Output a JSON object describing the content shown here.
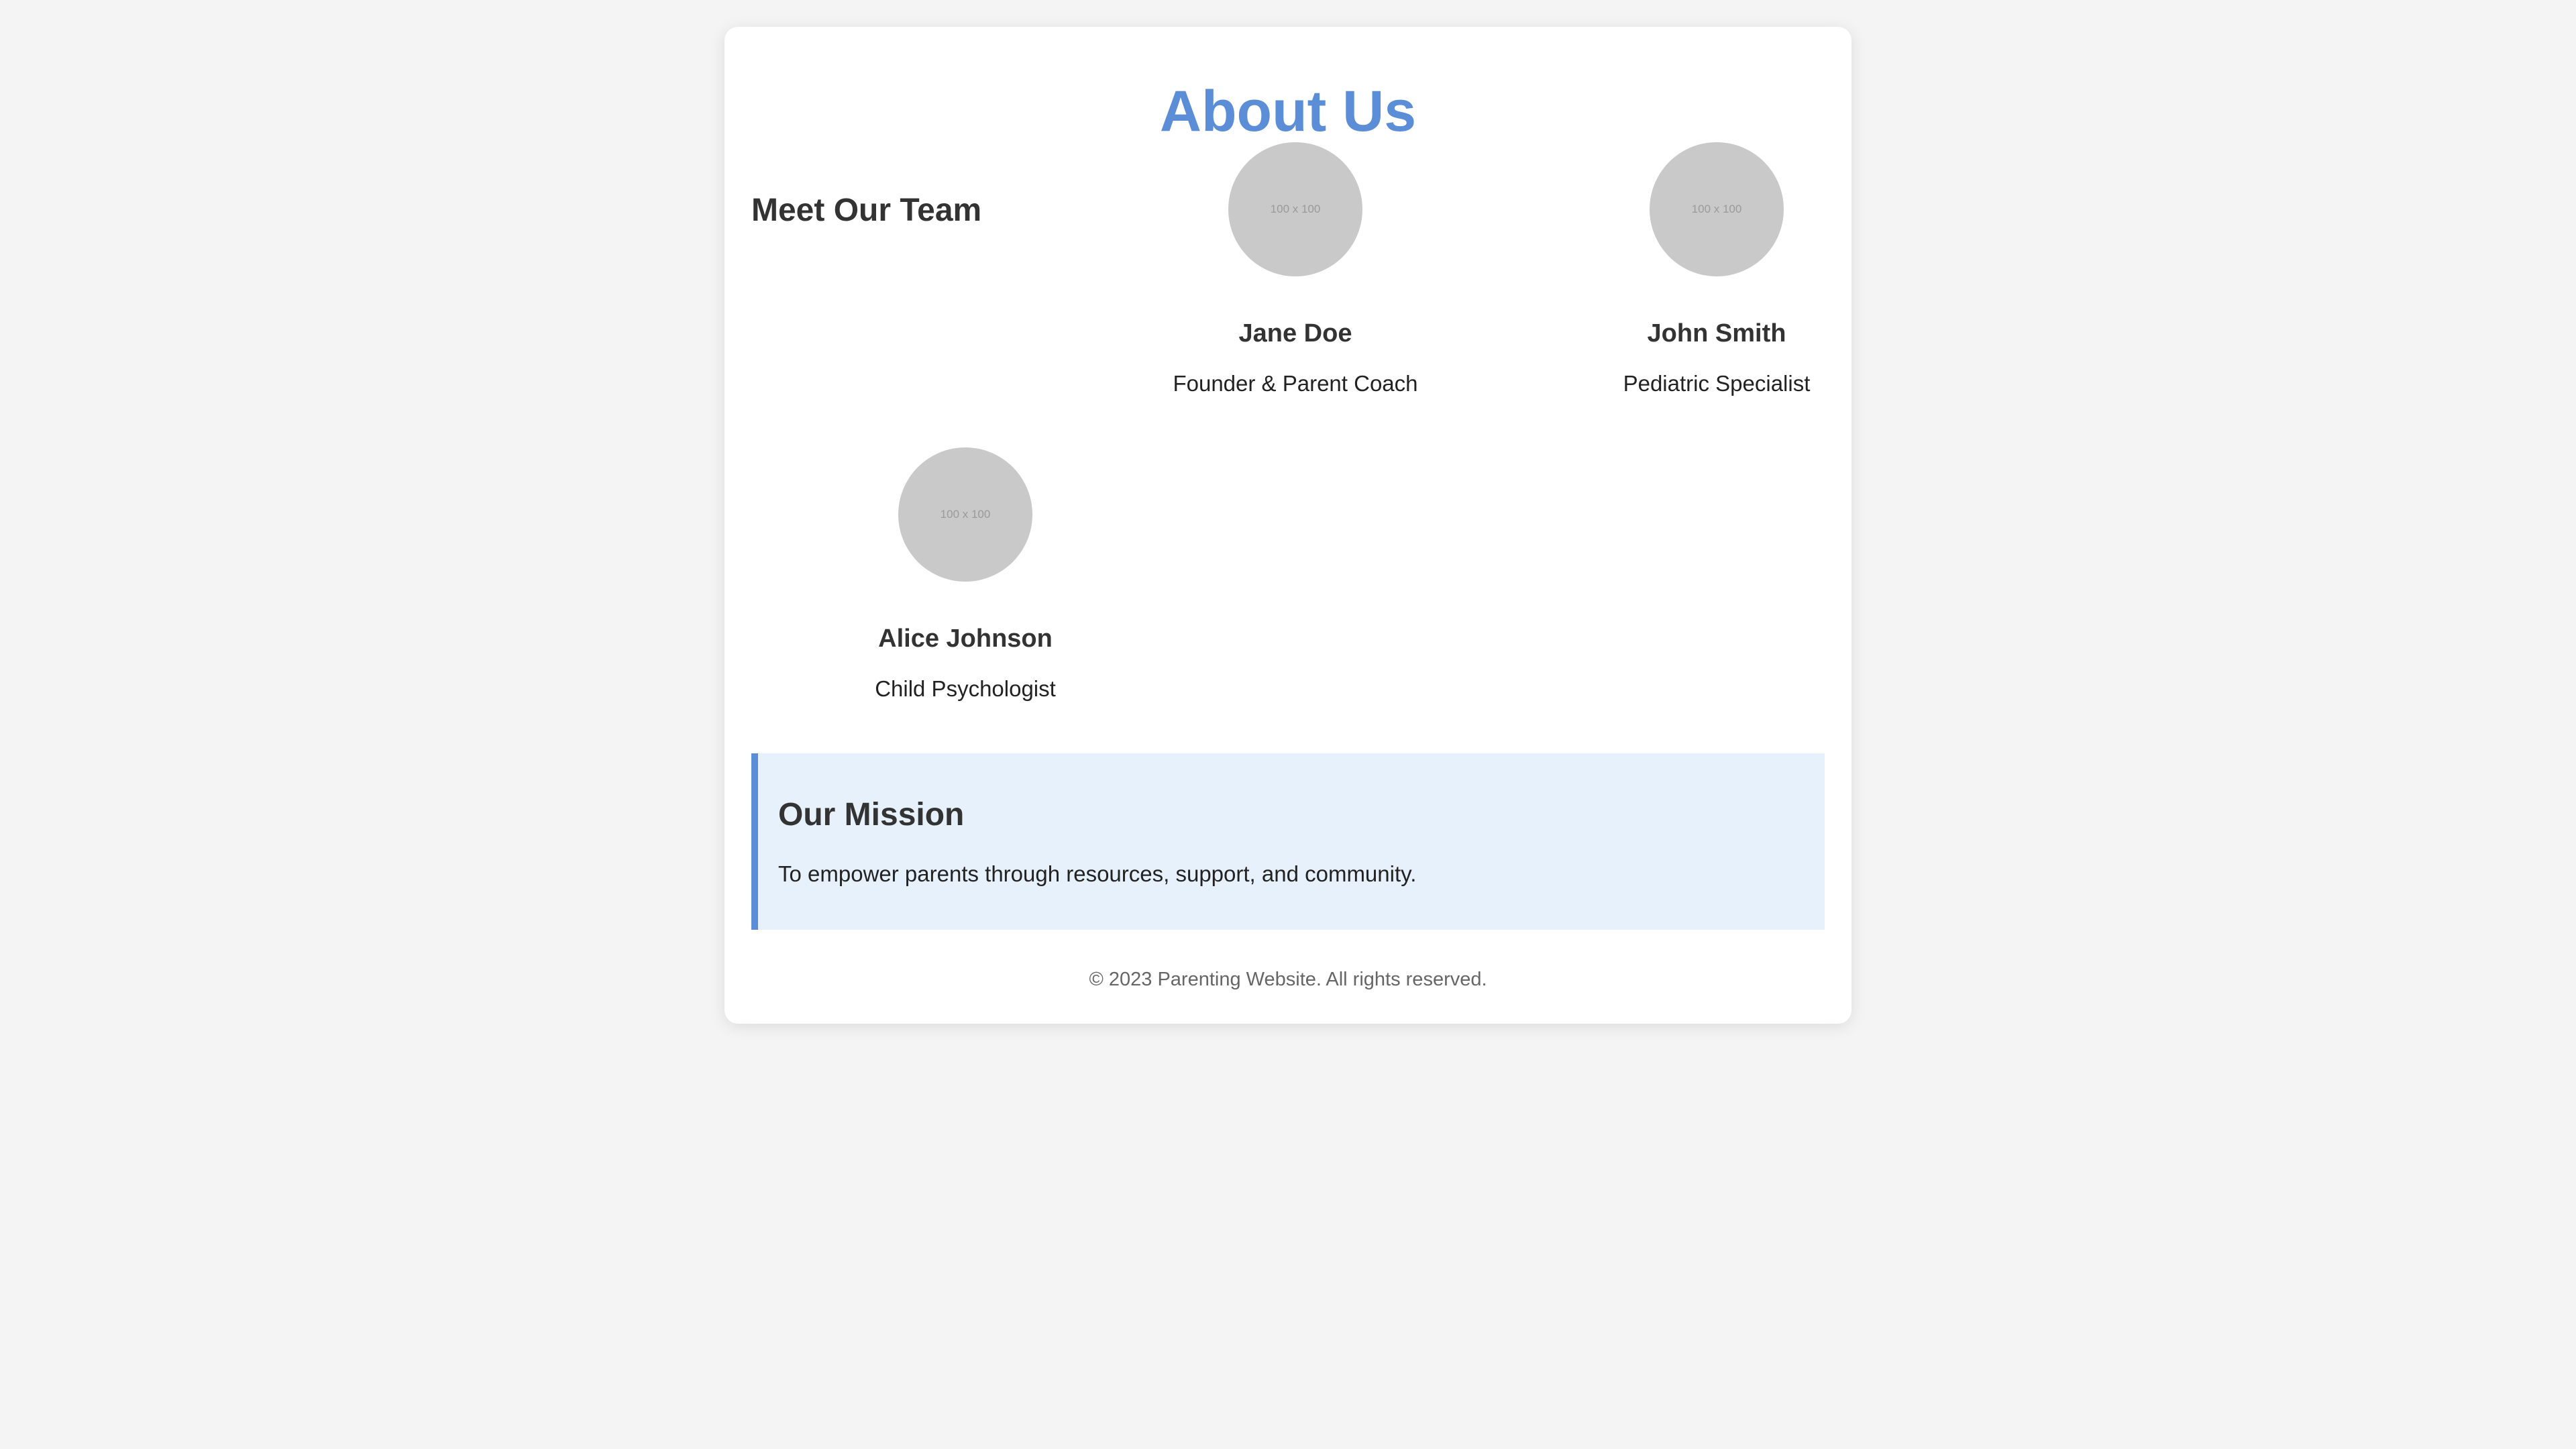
{
  "page": {
    "title": "About Us",
    "accent_color": "#5b8ed6",
    "background_color": "#f4f4f4"
  },
  "team": {
    "heading": "Meet Our Team",
    "members": [
      {
        "name": "Jane Doe",
        "role": "Founder & Parent Coach",
        "avatar_placeholder": "100 x 100"
      },
      {
        "name": "John Smith",
        "role": "Pediatric Specialist",
        "avatar_placeholder": "100 x 100"
      },
      {
        "name": "Alice Johnson",
        "role": "Child Psychologist",
        "avatar_placeholder": "100 x 100"
      }
    ]
  },
  "mission": {
    "heading": "Our Mission",
    "text": "To empower parents through resources, support, and community.",
    "background_color": "#e7f1fb"
  },
  "footer": {
    "text": "© 2023 Parenting Website. All rights reserved."
  }
}
